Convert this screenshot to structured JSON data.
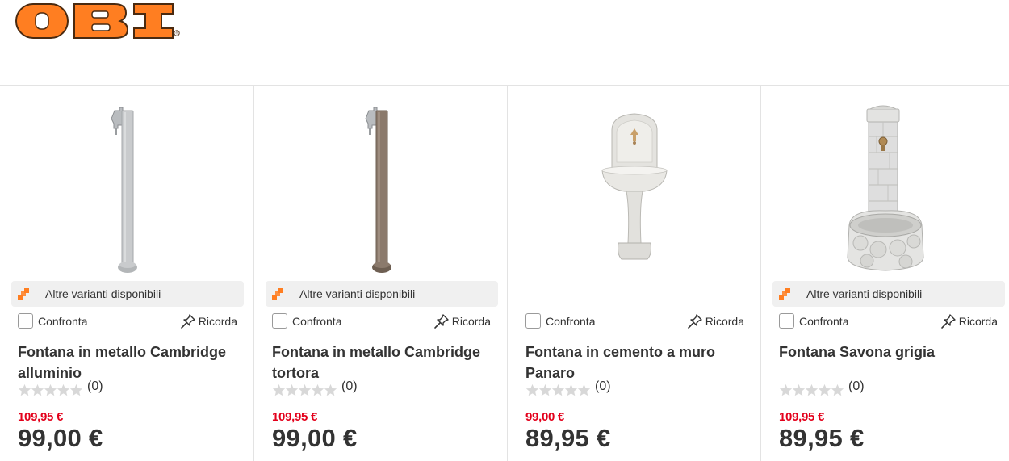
{
  "brand": {
    "logo_text": "OBI",
    "logo_color": "#ff7e21",
    "registered_mark": "®"
  },
  "colors": {
    "accent": "#ff7e21",
    "sale_red": "#e3001b",
    "text": "#333333",
    "variants_bg": "#f0f0f0",
    "star_empty": "#d8d8d8"
  },
  "icons": {
    "variants": "variants-icon",
    "checkbox": "checkbox",
    "remember": "pin-icon",
    "rating": "star-icon"
  },
  "products": [
    {
      "image": "fountain-pole-aluminium",
      "variants_label": "Altre varianti disponibili",
      "compare_label": "Confronta",
      "remember_label": "Ricorda",
      "title": "Fontana in metallo Cambridge alluminio",
      "rating_stars": 0,
      "rating_count": "(0)",
      "old_price": "109,95 €",
      "price": "99,00 €"
    },
    {
      "image": "fountain-pole-dove-grey",
      "variants_label": "Altre varianti disponibili",
      "compare_label": "Confronta",
      "remember_label": "Ricorda",
      "title": "Fontana in metallo Cambridge tortora",
      "rating_stars": 0,
      "rating_count": "(0)",
      "old_price": "109,95 €",
      "price": "99,00 €"
    },
    {
      "image": "wall-fountain-cement",
      "variants_label": "",
      "compare_label": "Confronta",
      "remember_label": "Ricorda",
      "title": "Fontana in cemento a muro Panaro",
      "rating_stars": 0,
      "rating_count": "(0)",
      "old_price": "99,00 €",
      "price": "89,95 €"
    },
    {
      "image": "stone-fountain-grey",
      "variants_label": "Altre varianti disponibili",
      "compare_label": "Confronta",
      "remember_label": "Ricorda",
      "title": "Fontana Savona grigia",
      "rating_stars": 0,
      "rating_count": "(0)",
      "old_price": "109,95 €",
      "price": "89,95 €"
    }
  ]
}
